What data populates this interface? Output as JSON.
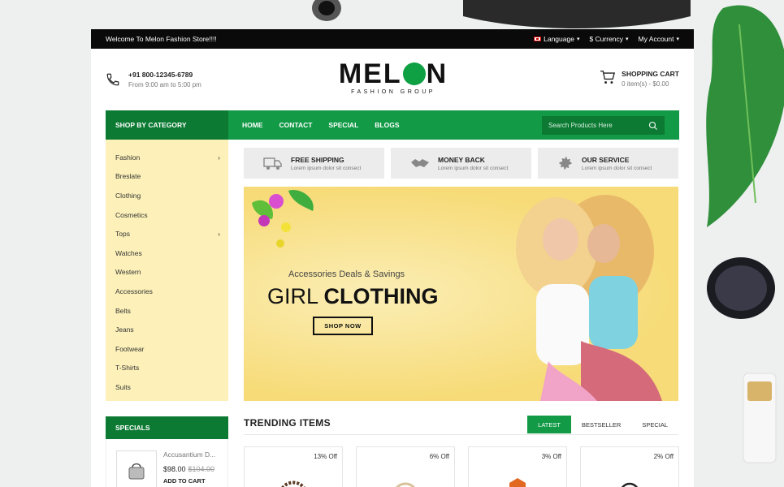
{
  "topbar": {
    "welcome": "Welcome To Melon Fashion Store!!!!",
    "language": "Language",
    "currency": "$ Currency",
    "account": "My Account"
  },
  "header": {
    "phone": "+91 800-12345-6789",
    "hours": "From 9:00 am to 5:00 pm",
    "logo_left": "MEL",
    "logo_right": "N",
    "logo_sub": "FASHION GROUP",
    "cart_title": "SHOPPING CART",
    "cart_summary": "0 item(s) - $0.00"
  },
  "nav": {
    "category_label": "SHOP BY CATEGORY",
    "links": [
      "HOME",
      "CONTACT",
      "SPECIAL",
      "BLOGS"
    ],
    "search_placeholder": "Search Products Here"
  },
  "sidebar": {
    "items": [
      {
        "label": "Fashion",
        "has_sub": true
      },
      {
        "label": "Breslate",
        "has_sub": false
      },
      {
        "label": "Clothing",
        "has_sub": false
      },
      {
        "label": "Cosmetics",
        "has_sub": false
      },
      {
        "label": "Tops",
        "has_sub": true
      },
      {
        "label": "Watches",
        "has_sub": false
      },
      {
        "label": "Western",
        "has_sub": false
      },
      {
        "label": "Accessories",
        "has_sub": false
      },
      {
        "label": "Belts",
        "has_sub": false
      },
      {
        "label": "Jeans",
        "has_sub": false
      },
      {
        "label": "Footwear",
        "has_sub": false
      },
      {
        "label": "T-Shirts",
        "has_sub": false
      },
      {
        "label": "Suits",
        "has_sub": false
      }
    ]
  },
  "services": [
    {
      "title": "FREE SHIPPING",
      "desc": "Lorem ipsum dolor sit consect",
      "icon": "truck-icon"
    },
    {
      "title": "MONEY BACK",
      "desc": "Lorem ipsum dolor sit consect",
      "icon": "handshake-icon"
    },
    {
      "title": "OUR SERVICE",
      "desc": "Lorem ipsum dolor sit consect",
      "icon": "gear-icon"
    }
  ],
  "banner": {
    "subtitle": "Accessories Deals & Savings",
    "title_light": "GIRL",
    "title_bold": "CLOTHING",
    "button": "SHOP NOW"
  },
  "specials": {
    "heading": "SPECIALS",
    "product": {
      "name": "Accusantium D...",
      "price": "$98.00",
      "old_price": "$104.00",
      "add": "ADD TO CART"
    }
  },
  "trending": {
    "title": "TRENDING ITEMS",
    "tabs": [
      "LATEST",
      "BESTSELLER",
      "SPECIAL"
    ],
    "active_tab": "LATEST",
    "products": [
      {
        "discount": "13% Off"
      },
      {
        "discount": "6% Off"
      },
      {
        "discount": "3% Off"
      },
      {
        "discount": "2% Off"
      }
    ]
  },
  "colors": {
    "brand_green": "#129a46",
    "dark_green": "#0c7a33",
    "sidebar_bg": "#fdf1b9",
    "topbar_bg": "#0a0a0a"
  }
}
